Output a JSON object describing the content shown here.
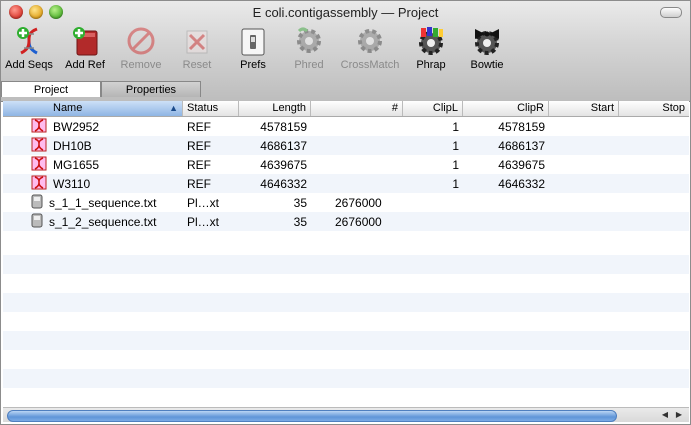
{
  "window": {
    "title": "E coli.contigassembly — Project"
  },
  "toolbar": {
    "items": [
      {
        "label": "Add Seqs",
        "icon": "add-seqs-icon",
        "enabled": true
      },
      {
        "label": "Add Ref",
        "icon": "add-ref-icon",
        "enabled": true
      },
      {
        "label": "Remove",
        "icon": "remove-icon",
        "enabled": false
      },
      {
        "label": "Reset",
        "icon": "reset-icon",
        "enabled": false
      },
      {
        "label": "Prefs",
        "icon": "prefs-icon",
        "enabled": true
      },
      {
        "label": "Phred",
        "icon": "phred-icon",
        "enabled": false
      },
      {
        "label": "CrossMatch",
        "icon": "crossmatch-icon",
        "enabled": false
      },
      {
        "label": "Phrap",
        "icon": "phrap-icon",
        "enabled": true
      },
      {
        "label": "Bowtie",
        "icon": "bowtie-icon",
        "enabled": true
      }
    ]
  },
  "tabs": [
    {
      "label": "Project",
      "active": true
    },
    {
      "label": "Properties",
      "active": false
    }
  ],
  "table": {
    "columns": [
      "Name",
      "Status",
      "Length",
      "#",
      "ClipL",
      "ClipR",
      "Start",
      "Stop"
    ],
    "sort_column": "Name",
    "rows": [
      {
        "name": "BW2952",
        "icon": "dna-file-icon",
        "status": "REF",
        "length": "4578159",
        "count": "",
        "clipl": "1",
        "clipr": "4578159",
        "start": "",
        "stop": ""
      },
      {
        "name": "DH10B",
        "icon": "dna-file-icon",
        "status": "REF",
        "length": "4686137",
        "count": "",
        "clipl": "1",
        "clipr": "4686137",
        "start": "",
        "stop": ""
      },
      {
        "name": "MG1655",
        "icon": "dna-file-icon",
        "status": "REF",
        "length": "4639675",
        "count": "",
        "clipl": "1",
        "clipr": "4639675",
        "start": "",
        "stop": ""
      },
      {
        "name": "W3110",
        "icon": "dna-file-icon",
        "status": "REF",
        "length": "4646332",
        "count": "",
        "clipl": "1",
        "clipr": "4646332",
        "start": "",
        "stop": ""
      },
      {
        "name": "s_1_1_sequence.txt",
        "icon": "text-file-icon",
        "status": "Pl…xt",
        "length": "35",
        "count": "2676000",
        "clipl": "",
        "clipr": "",
        "start": "",
        "stop": ""
      },
      {
        "name": "s_1_2_sequence.txt",
        "icon": "text-file-icon",
        "status": "Pl…xt",
        "length": "35",
        "count": "2676000",
        "clipl": "",
        "clipr": "",
        "start": "",
        "stop": ""
      }
    ]
  },
  "colors": {
    "selected_header": "#8fb5e4",
    "alt_row": "#f1f5fb",
    "scroll_thumb": "#5f95d8"
  }
}
